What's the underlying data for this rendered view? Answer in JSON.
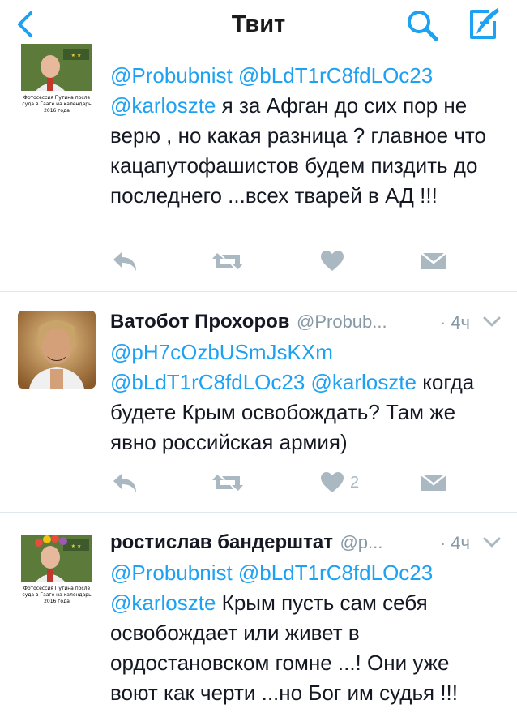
{
  "nav": {
    "title": "Твит"
  },
  "colors": {
    "accent": "#1da1f2",
    "muted": "#aab8c2",
    "text": "#141823"
  },
  "tweets": [
    {
      "body_mentions": "@Probubnist @bLdT1rC8fdLOc23 @karloszte",
      "body_text": "я за Афган до сих пор не верю , но какая разница ? главное что кацапутофашистов будем пиздить до последнего ...всех тварей в АД !!!",
      "avatar_caption": "Фотосессия Путина после суда в Гааге на календарь 2016 года",
      "like_count": ""
    },
    {
      "name": "Ватобот Прохоров",
      "handle": "@Probub...",
      "time": "· 4ч",
      "body_mentions": "@pH7cOzbUSmJsKXm @bLdT1rC8fdLOc23 @karloszte",
      "body_text": "когда будете Крым освобождать? Там же явно российская армия)",
      "like_count": "2"
    },
    {
      "name": "ростислав бандерштат",
      "handle": "@p...",
      "time": "· 4ч",
      "body_mentions": "@Probubnist @bLdT1rC8fdLOc23 @karloszte",
      "body_text": "Крым пусть сам себя освобождает или живет в ордостановском гомне ...! Они уже воют как черти ...но Бог им судья !!!",
      "avatar_caption": "Фотосессия Путина после суда в Гааге на календарь 2016 года"
    }
  ]
}
